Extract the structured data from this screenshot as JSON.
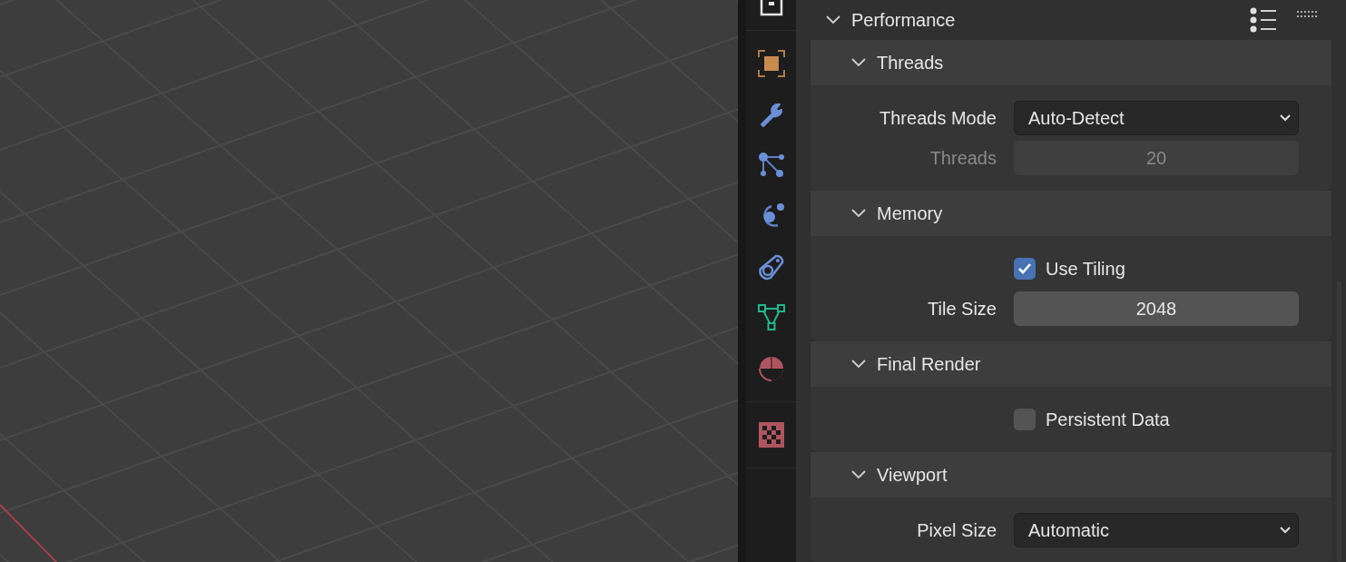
{
  "panel": {
    "title": "Performance",
    "expanded": true,
    "subpanels": [
      {
        "title": "Threads",
        "expanded": true,
        "rows": [
          {
            "kind": "dropdown",
            "label": "Threads Mode",
            "value": "Auto-Detect",
            "disabled": false
          },
          {
            "kind": "number",
            "label": "Threads",
            "value": "20",
            "disabled": true
          }
        ]
      },
      {
        "title": "Memory",
        "expanded": true,
        "rows": [
          {
            "kind": "checkbox",
            "label": "Use Tiling",
            "checked": true
          },
          {
            "kind": "number",
            "label": "Tile Size",
            "value": "2048",
            "disabled": false
          }
        ]
      },
      {
        "title": "Final Render",
        "expanded": true,
        "rows": [
          {
            "kind": "checkbox",
            "label": "Persistent Data",
            "checked": false
          }
        ]
      },
      {
        "title": "Viewport",
        "expanded": true,
        "rows": [
          {
            "kind": "dropdown",
            "label": "Pixel Size",
            "value": "Automatic",
            "disabled": false
          }
        ]
      }
    ]
  }
}
